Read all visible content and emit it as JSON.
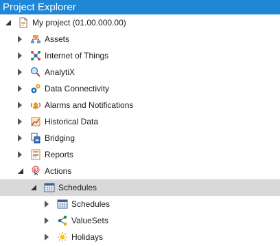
{
  "panel": {
    "title": "Project Explorer"
  },
  "tree": {
    "root": {
      "label": "My project (01.00.000.00)",
      "icon": "project-document-icon",
      "expanded": true
    },
    "items": [
      {
        "label": "Assets",
        "icon": "assets-icon",
        "expanded": false
      },
      {
        "label": "Internet of Things",
        "icon": "iot-network-icon",
        "expanded": false
      },
      {
        "label": "AnalytiX",
        "icon": "analytix-icon",
        "expanded": false
      },
      {
        "label": "Data Connectivity",
        "icon": "gears-icon",
        "expanded": false
      },
      {
        "label": "Alarms and Notifications",
        "icon": "alarm-bell-icon",
        "expanded": false
      },
      {
        "label": "Historical Data",
        "icon": "historical-data-icon",
        "expanded": false
      },
      {
        "label": "Bridging",
        "icon": "bridging-icon",
        "expanded": false
      },
      {
        "label": "Reports",
        "icon": "reports-icon",
        "expanded": false
      },
      {
        "label": "Actions",
        "icon": "actions-icon",
        "expanded": true
      }
    ],
    "actions_children": [
      {
        "label": "Schedules",
        "icon": "calendar-grid-icon",
        "expanded": true,
        "selected": true
      }
    ],
    "schedules_children": [
      {
        "label": "Schedules",
        "icon": "calendar-grid-icon",
        "expanded": false
      },
      {
        "label": "ValueSets",
        "icon": "valuesets-icon",
        "expanded": false
      },
      {
        "label": "Holidays",
        "icon": "sun-icon",
        "expanded": false
      }
    ]
  }
}
